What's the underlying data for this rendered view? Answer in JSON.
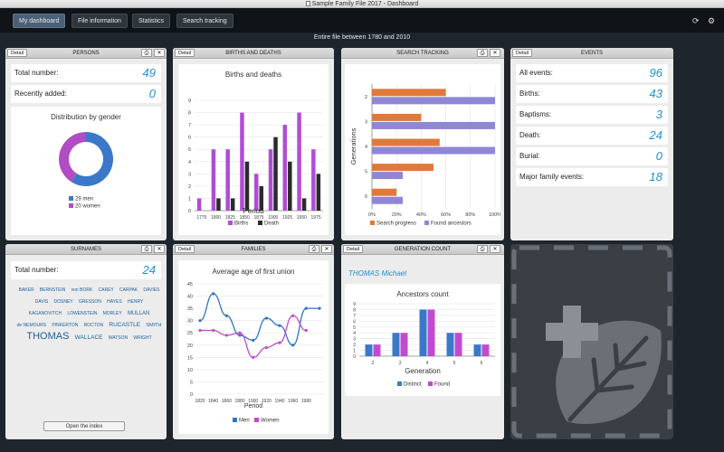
{
  "window": {
    "title": "Sample Family File 2017 - Dashboard"
  },
  "toolbar": {
    "buttons": [
      "My dashboard",
      "File information",
      "Statistics",
      "Search tracking"
    ],
    "refresh_icon": "refresh-icon",
    "settings_icon": "settings-gear-icon"
  },
  "subtitle": "Entire file between 1780 and 2010",
  "common": {
    "detail": "Detail"
  },
  "persons": {
    "title": "PERSONS",
    "total_label": "Total number:",
    "total_value": "49",
    "recent_label": "Recently added:",
    "recent_value": "0",
    "chart_title": "Distribution by gender",
    "men_label": "29 men",
    "women_label": "20 women"
  },
  "births": {
    "title": "BIRTHS AND DEATHS",
    "chart_title": "Births and deaths",
    "xlabel": "Period",
    "legend": [
      "Births",
      "Death"
    ]
  },
  "search": {
    "title": "SEARCH TRACKING",
    "ylabel": "Generations",
    "legend": [
      "Search progress",
      "Found ancestors"
    ]
  },
  "events": {
    "title": "EVENTS",
    "rows": [
      {
        "label": "All events:",
        "value": "96"
      },
      {
        "label": "Births:",
        "value": "43"
      },
      {
        "label": "Baptisms:",
        "value": "3"
      },
      {
        "label": "Death:",
        "value": "24"
      },
      {
        "label": "Burial:",
        "value": "0"
      },
      {
        "label": "Major family events:",
        "value": "18"
      }
    ]
  },
  "surnames": {
    "title": "SURNAMES",
    "total_label": "Total number:",
    "total_value": "24",
    "cloud": [
      {
        "t": "BAKER",
        "s": 5
      },
      {
        "t": "BERNSTEIN",
        "s": 5
      },
      {
        "t": "von BORK",
        "s": 5
      },
      {
        "t": "CAREY",
        "s": 5
      },
      {
        "t": "CARPAK",
        "s": 5
      },
      {
        "t": "DAVIES",
        "s": 5
      },
      {
        "t": "DAVIS",
        "s": 5
      },
      {
        "t": "DOSNEY",
        "s": 5
      },
      {
        "t": "GRESSON",
        "s": 5
      },
      {
        "t": "HAYES",
        "s": 5
      },
      {
        "t": "HENRY",
        "s": 5
      },
      {
        "t": "KAGANOVITCH",
        "s": 5
      },
      {
        "t": "LOWENSTEIN",
        "s": 5
      },
      {
        "t": "MORLEY",
        "s": 5
      },
      {
        "t": "MULLAN",
        "s": 6
      },
      {
        "t": "de NEMOURS",
        "s": 5
      },
      {
        "t": "PINKERTON",
        "s": 5
      },
      {
        "t": "ROCTON",
        "s": 5
      },
      {
        "t": "RUCASTLE",
        "s": 6.5
      },
      {
        "t": "SMITH",
        "s": 5.5
      },
      {
        "t": "THOMAS",
        "s": 11
      },
      {
        "t": "WALLACE",
        "s": 6.5
      },
      {
        "t": "WATSON",
        "s": 5
      },
      {
        "t": "WRIGHT",
        "s": 5
      }
    ],
    "open_index": "Open the index"
  },
  "families": {
    "title": "FAMILIES",
    "chart_title": "Average age of first union",
    "xlabel": "Period",
    "legend": [
      "Men",
      "Women"
    ]
  },
  "gencount": {
    "title": "GENERATION COUNT",
    "person": "THOMAS Michael",
    "chart_title": "Ancestors count",
    "xlabel": "Generation",
    "legend": [
      "Distinct",
      "Found"
    ]
  },
  "chart_data": [
    {
      "id": "gender",
      "type": "pie",
      "categories": [
        "men",
        "women"
      ],
      "values": [
        29,
        20
      ],
      "title": "Distribution by gender",
      "colors": [
        "#3b78c9",
        "#b04cc4"
      ]
    },
    {
      "id": "births",
      "type": "bar",
      "title": "Births and deaths",
      "xlabel": "Period",
      "ylabel": "",
      "categories": [
        "1775",
        "1800",
        "1825",
        "1850",
        "1875",
        "1900",
        "1925",
        "1950",
        "1975"
      ],
      "series": [
        {
          "name": "Births",
          "values": [
            1,
            5,
            5,
            8,
            3,
            5,
            7,
            8,
            5
          ],
          "color": "#b04cd6"
        },
        {
          "name": "Death",
          "values": [
            0,
            1,
            1,
            4,
            2,
            6,
            4,
            1,
            3
          ],
          "color": "#2b2b2b"
        }
      ],
      "ylim": [
        0,
        9
      ],
      "yticks": [
        0,
        1,
        2,
        3,
        4,
        5,
        6,
        7,
        8,
        9
      ]
    },
    {
      "id": "search",
      "type": "bar",
      "orientation": "horizontal",
      "ylabel": "Generations",
      "categories": [
        "2",
        "3",
        "4",
        "5",
        "6"
      ],
      "series": [
        {
          "name": "Search progress",
          "values": [
            60,
            40,
            55,
            50,
            20
          ],
          "color": "#e07a3a"
        },
        {
          "name": "Found ancestors",
          "values": [
            100,
            100,
            100,
            25,
            25
          ],
          "color": "#8f87d6"
        }
      ],
      "xlim": [
        0,
        100
      ],
      "xticks": [
        "0%",
        "20%",
        "40%",
        "60%",
        "80%",
        "100%"
      ]
    },
    {
      "id": "families",
      "type": "line",
      "title": "Average age of first union",
      "xlabel": "Period",
      "x": [
        1820,
        1840,
        1860,
        1880,
        1900,
        1920,
        1940,
        1960,
        1980,
        2000
      ],
      "series": [
        {
          "name": "Men",
          "values": [
            30,
            41,
            32,
            24,
            22,
            31,
            28,
            20,
            35,
            35
          ],
          "color": "#2e76c0"
        },
        {
          "name": "Women",
          "values": [
            26,
            26,
            24,
            25,
            15,
            19,
            21,
            32,
            26,
            null
          ],
          "color": "#c24ad0"
        }
      ],
      "ylim": [
        0,
        45
      ],
      "yticks": [
        0,
        5,
        10,
        15,
        20,
        25,
        30,
        35,
        40,
        45
      ],
      "xticks": [
        "1820",
        "1840",
        "1860",
        "1880",
        "1900",
        "1920",
        "1940",
        "1960",
        "1980"
      ]
    },
    {
      "id": "ancestors",
      "type": "bar",
      "title": "Ancestors count",
      "xlabel": "Generation",
      "categories": [
        "2",
        "3",
        "4",
        "5",
        "6"
      ],
      "series": [
        {
          "name": "Distinct",
          "values": [
            2,
            4,
            8,
            4,
            2
          ],
          "color": "#3b78c9"
        },
        {
          "name": "Found",
          "values": [
            2,
            4,
            8,
            4,
            2
          ],
          "color": "#c24ad0"
        }
      ],
      "ylim": [
        0,
        9
      ],
      "yticks": [
        0,
        1,
        2,
        3,
        4,
        5,
        6,
        7,
        8,
        9
      ]
    }
  ]
}
